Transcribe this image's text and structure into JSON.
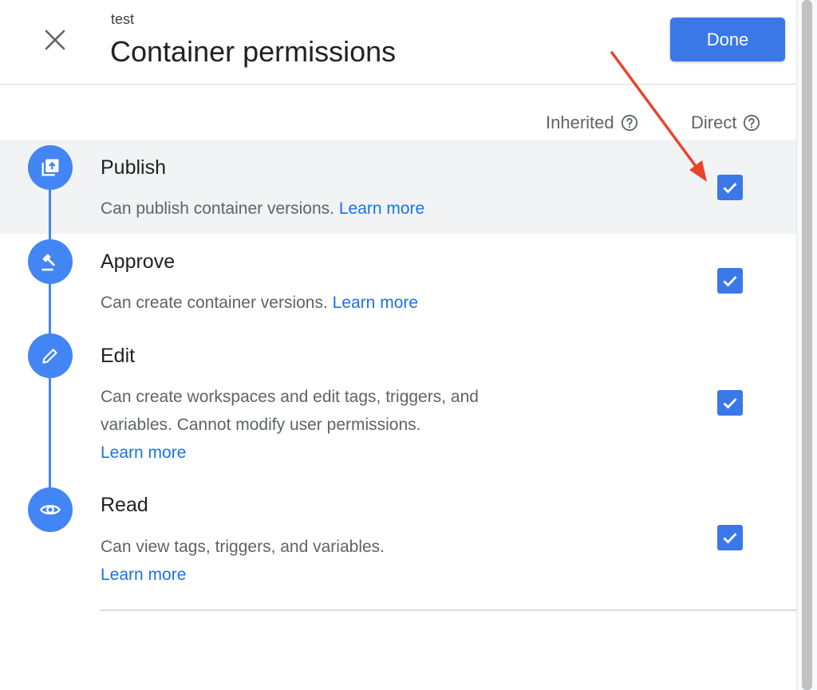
{
  "header": {
    "subtitle": "test",
    "title": "Container permissions",
    "done_label": "Done"
  },
  "columns": {
    "inherited_label": "Inherited",
    "direct_label": "Direct"
  },
  "permissions": [
    {
      "title": "Publish",
      "description": "Can publish container versions.",
      "link": "Learn more",
      "icon": "publish-icon",
      "direct_checked": true,
      "highlighted": true
    },
    {
      "title": "Approve",
      "description": "Can create container versions.",
      "link": "Learn more",
      "icon": "gavel-icon",
      "direct_checked": true
    },
    {
      "title": "Edit",
      "description": "Can create workspaces and edit tags, triggers, and variables. Cannot modify user permissions.",
      "link": "Learn more",
      "icon": "pencil-icon",
      "direct_checked": true
    },
    {
      "title": "Read",
      "description": "Can view tags, triggers, and variables.",
      "link": "Learn more",
      "icon": "eye-icon",
      "direct_checked": true
    }
  ],
  "colors": {
    "primary": "#3b78e7",
    "timeline": "#4285f4",
    "link": "#1a73e8",
    "annotation_arrow": "#e8452c",
    "highlight_row": "#f1f3f4"
  }
}
